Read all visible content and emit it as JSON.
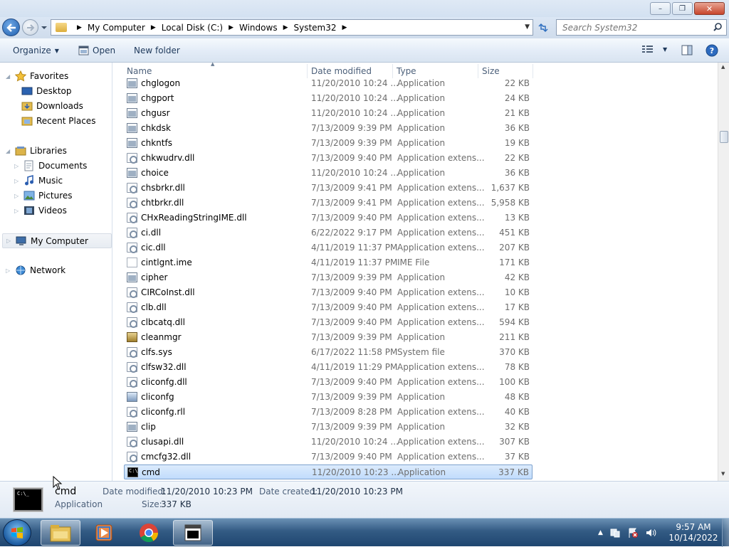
{
  "window": {
    "minimize": "–",
    "maximize": "❐",
    "close": "✕"
  },
  "address": {
    "crumbs": [
      "My Computer",
      "Local Disk (C:)",
      "Windows",
      "System32"
    ]
  },
  "search": {
    "placeholder": "Search System32"
  },
  "toolbar": {
    "organize": "Organize",
    "open": "Open",
    "new_folder": "New folder"
  },
  "sidebar": {
    "favorites": "Favorites",
    "desktop": "Desktop",
    "downloads": "Downloads",
    "recent": "Recent Places",
    "libraries": "Libraries",
    "documents": "Documents",
    "music": "Music",
    "pictures": "Pictures",
    "videos": "Videos",
    "computer": "My Computer",
    "network": "Network"
  },
  "columns": {
    "name": "Name",
    "date": "Date modified",
    "type": "Type",
    "size": "Size"
  },
  "files": [
    {
      "name": "chglogon",
      "date": "11/20/2010 10:24 ...",
      "type": "Application",
      "size": "22 KB",
      "icon": "app"
    },
    {
      "name": "chgport",
      "date": "11/20/2010 10:24 ...",
      "type": "Application",
      "size": "24 KB",
      "icon": "app"
    },
    {
      "name": "chgusr",
      "date": "11/20/2010 10:24 ...",
      "type": "Application",
      "size": "21 KB",
      "icon": "app"
    },
    {
      "name": "chkdsk",
      "date": "7/13/2009 9:39 PM",
      "type": "Application",
      "size": "36 KB",
      "icon": "app"
    },
    {
      "name": "chkntfs",
      "date": "7/13/2009 9:39 PM",
      "type": "Application",
      "size": "19 KB",
      "icon": "app"
    },
    {
      "name": "chkwudrv.dll",
      "date": "7/13/2009 9:40 PM",
      "type": "Application extens...",
      "size": "22 KB",
      "icon": "dll"
    },
    {
      "name": "choice",
      "date": "11/20/2010 10:24 ...",
      "type": "Application",
      "size": "36 KB",
      "icon": "app"
    },
    {
      "name": "chsbrkr.dll",
      "date": "7/13/2009 9:41 PM",
      "type": "Application extens...",
      "size": "1,637 KB",
      "icon": "dll"
    },
    {
      "name": "chtbrkr.dll",
      "date": "7/13/2009 9:41 PM",
      "type": "Application extens...",
      "size": "5,958 KB",
      "icon": "dll"
    },
    {
      "name": "CHxReadingStringIME.dll",
      "date": "7/13/2009 9:40 PM",
      "type": "Application extens...",
      "size": "13 KB",
      "icon": "dll"
    },
    {
      "name": "ci.dll",
      "date": "6/22/2022 9:17 PM",
      "type": "Application extens...",
      "size": "451 KB",
      "icon": "dll"
    },
    {
      "name": "cic.dll",
      "date": "4/11/2019 11:37 PM",
      "type": "Application extens...",
      "size": "207 KB",
      "icon": "dll"
    },
    {
      "name": "cintlgnt.ime",
      "date": "4/11/2019 11:37 PM",
      "type": "IME File",
      "size": "171 KB",
      "icon": "file"
    },
    {
      "name": "cipher",
      "date": "7/13/2009 9:39 PM",
      "type": "Application",
      "size": "42 KB",
      "icon": "app"
    },
    {
      "name": "CIRCoInst.dll",
      "date": "7/13/2009 9:40 PM",
      "type": "Application extens...",
      "size": "10 KB",
      "icon": "dll"
    },
    {
      "name": "clb.dll",
      "date": "7/13/2009 9:40 PM",
      "type": "Application extens...",
      "size": "17 KB",
      "icon": "dll"
    },
    {
      "name": "clbcatq.dll",
      "date": "7/13/2009 9:40 PM",
      "type": "Application extens...",
      "size": "594 KB",
      "icon": "dll"
    },
    {
      "name": "cleanmgr",
      "date": "7/13/2009 9:39 PM",
      "type": "Application",
      "size": "211 KB",
      "icon": "clean"
    },
    {
      "name": "clfs.sys",
      "date": "6/17/2022 11:58 PM",
      "type": "System file",
      "size": "370 KB",
      "icon": "dll"
    },
    {
      "name": "clfsw32.dll",
      "date": "4/11/2019 11:29 PM",
      "type": "Application extens...",
      "size": "78 KB",
      "icon": "dll"
    },
    {
      "name": "cliconfg.dll",
      "date": "7/13/2009 9:40 PM",
      "type": "Application extens...",
      "size": "100 KB",
      "icon": "dll"
    },
    {
      "name": "cliconfg",
      "date": "7/13/2009 9:39 PM",
      "type": "Application",
      "size": "48 KB",
      "icon": "cfg"
    },
    {
      "name": "cliconfg.rll",
      "date": "7/13/2009 8:28 PM",
      "type": "Application extens...",
      "size": "40 KB",
      "icon": "dll"
    },
    {
      "name": "clip",
      "date": "7/13/2009 9:39 PM",
      "type": "Application",
      "size": "32 KB",
      "icon": "app"
    },
    {
      "name": "clusapi.dll",
      "date": "11/20/2010 10:24 ...",
      "type": "Application extens...",
      "size": "307 KB",
      "icon": "dll"
    },
    {
      "name": "cmcfg32.dll",
      "date": "7/13/2009 9:40 PM",
      "type": "Application extens...",
      "size": "37 KB",
      "icon": "dll"
    },
    {
      "name": "cmd",
      "date": "11/20/2010 10:23 ...",
      "type": "Application",
      "size": "337 KB",
      "icon": "cmd",
      "selected": true
    }
  ],
  "details": {
    "icon_text": "C:\\_",
    "name": "cmd",
    "kind": "Application",
    "modified_label": "Date modified:",
    "modified": "11/20/2010 10:23 PM",
    "created_label": "Date created:",
    "created": "11/20/2010 10:23 PM",
    "size_label": "Size:",
    "size": "337 KB"
  },
  "clock": {
    "time": "9:57 AM",
    "date": "10/14/2022"
  }
}
